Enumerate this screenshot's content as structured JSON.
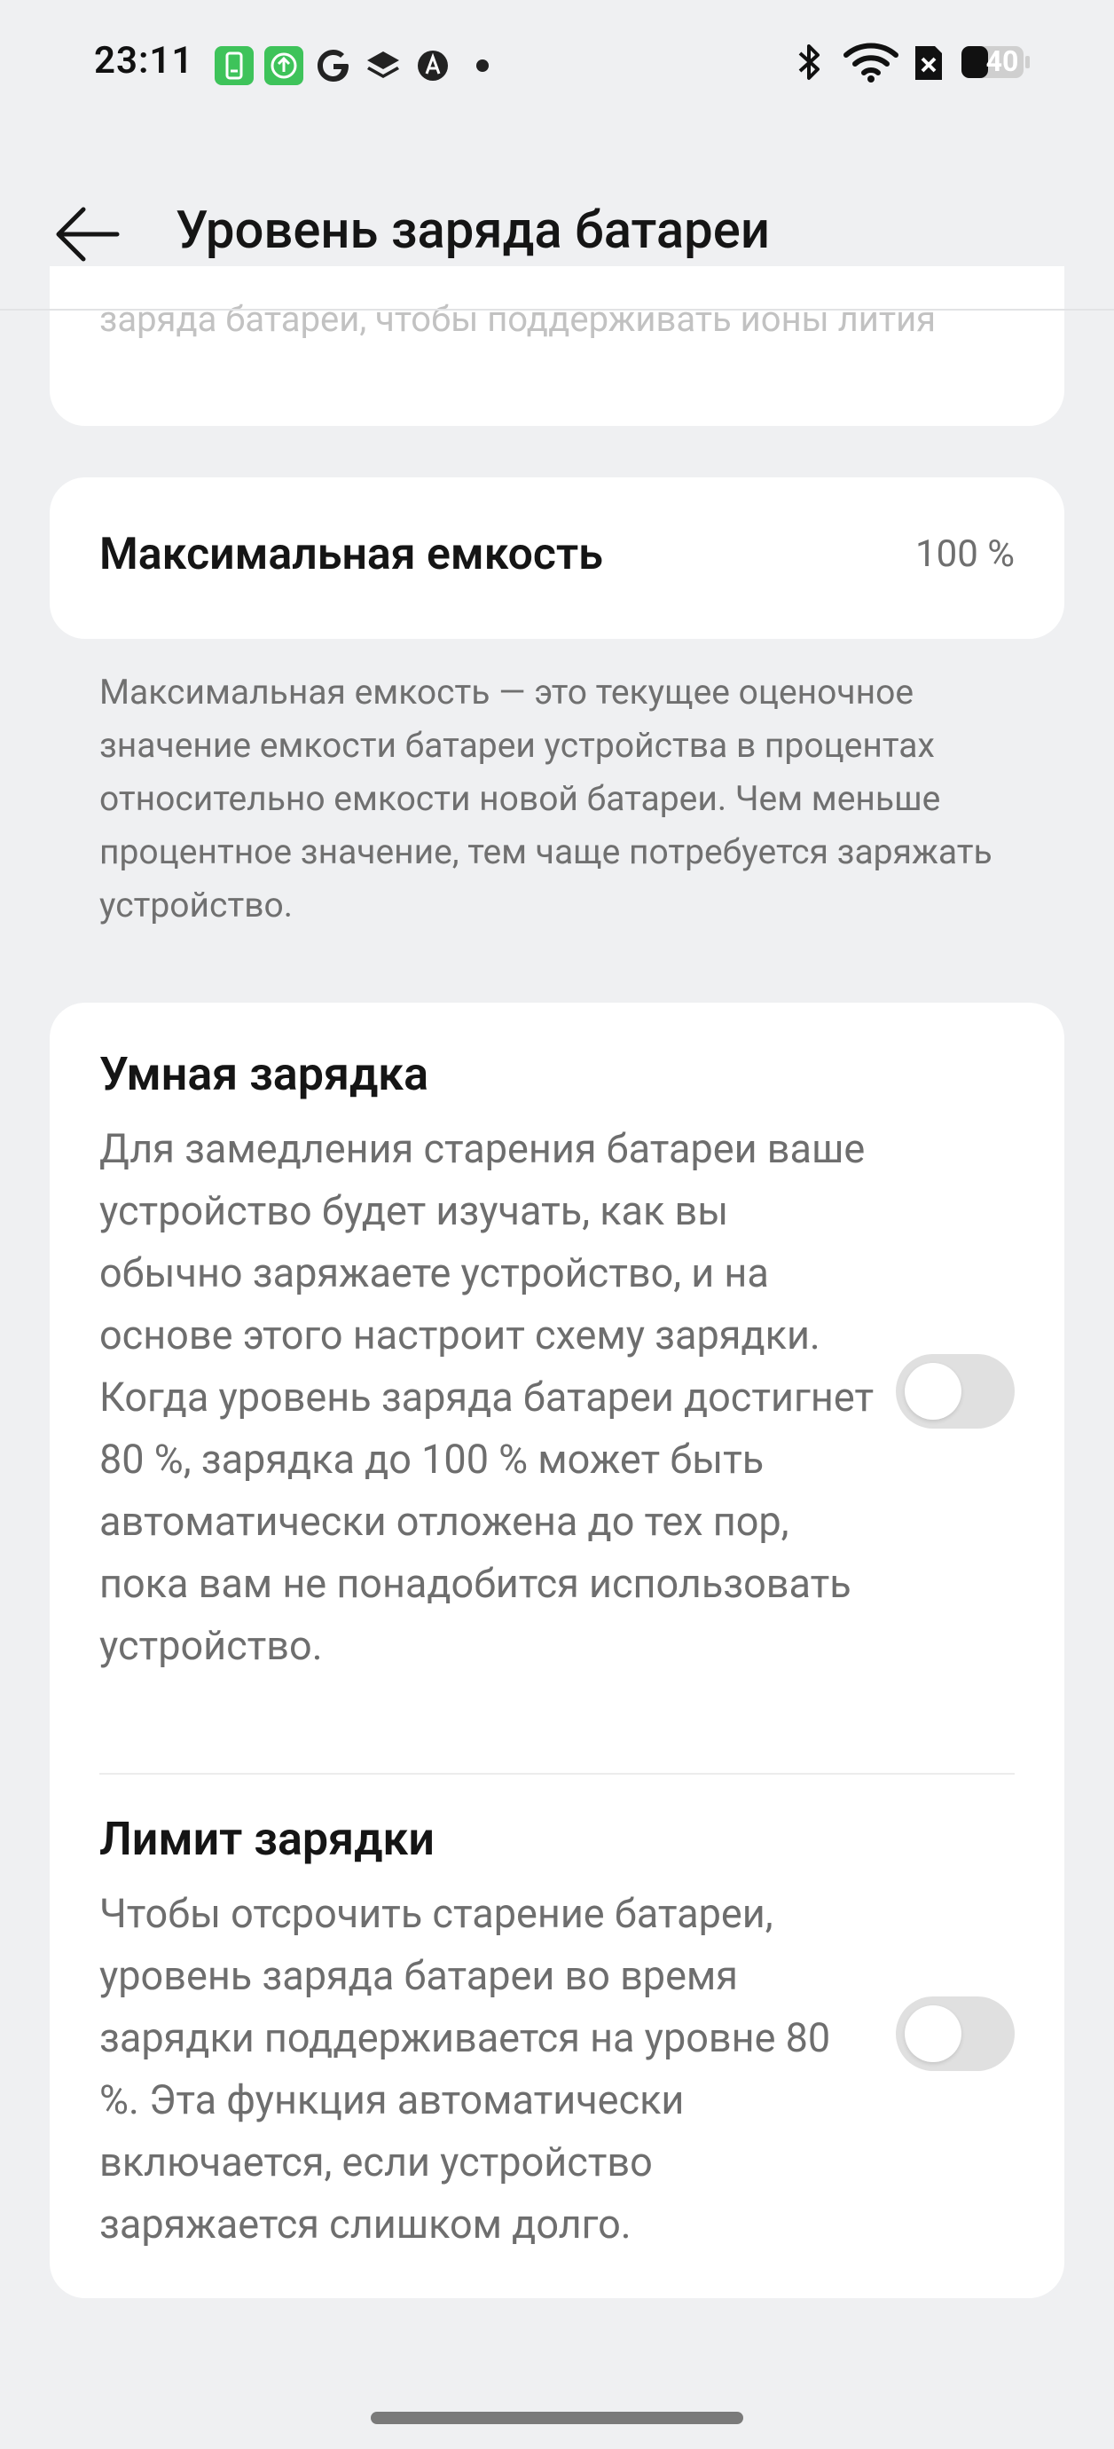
{
  "status_bar": {
    "time": "23:11",
    "battery_level": "40",
    "left_icons": [
      "app-icon-green",
      "app-icon-upload",
      "google-icon",
      "layers-icon",
      "gear-a-icon",
      "dot-icon"
    ],
    "right_icons": [
      "bluetooth-icon",
      "wifi-icon",
      "sim-blocked-icon",
      "battery-icon"
    ]
  },
  "header": {
    "title": "Уровень заряда батареи",
    "back_icon": "arrow-left-icon"
  },
  "cards": {
    "faded_text": "заряда батареи, чтобы поддерживать ионы лития",
    "max_capacity": {
      "label": "Максимальная емкость",
      "value": "100 %"
    },
    "max_capacity_description": "Максимальная емкость — это текущее оценочное значение емкости батареи устройства в процентах относительно емкости новой батареи. Чем меньше процентное значение, тем чаще потребуется заряжать устройство.",
    "smart_charging": {
      "title": "Умная зарядка",
      "body": "Для замедления старения батареи ваше устройство будет изучать, как вы обычно заряжаете устройство, и на основе этого настроит схему зарядки. Когда уровень заряда батареи достигнет 80 %, зарядка до 100 % может быть автоматически отложена до тех пор, пока вам не понадобится использовать устройство.",
      "enabled": false
    },
    "charge_limit": {
      "title": "Лимит зарядки",
      "body": "Чтобы отсрочить старение батареи, уровень заряда батареи во время зарядки поддерживается на уровне 80 %. Эта функция автоматически включается, если устройство заряжается слишком долго.",
      "enabled": false
    }
  },
  "colors": {
    "background": "#eff0f2",
    "card": "#ffffff",
    "toggle_off": "#e0e0e0"
  }
}
